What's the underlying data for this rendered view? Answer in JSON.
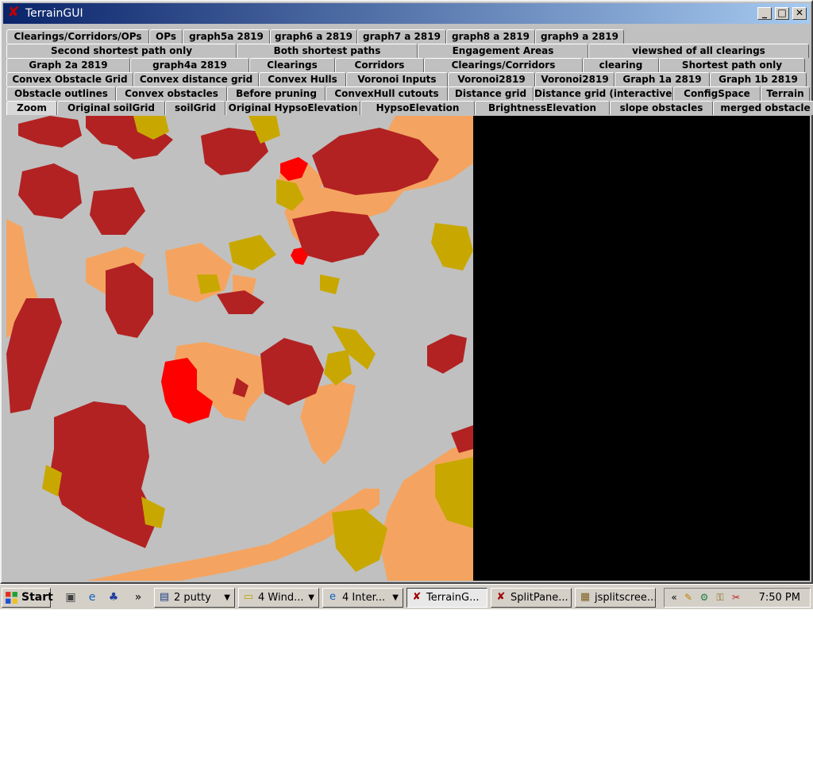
{
  "window": {
    "title": "TerrainGUI"
  },
  "tab_rows": [
    [
      "Clearings/Corridors/OPs",
      "OPs",
      "graph5a 2819",
      "graph6 a 2819",
      "graph7 a 2819",
      "graph8 a 2819",
      "graph9 a 2819"
    ],
    [
      "Second shortest path only",
      "Both shortest paths",
      "Engagement Areas",
      "viewshed of all clearings"
    ],
    [
      "Graph 2a 2819",
      "graph4a 2819",
      "Clearings",
      "Corridors",
      "Clearings/Corridors",
      "clearing",
      "Shortest path only"
    ],
    [
      "Convex Obstacle Grid",
      "Convex distance grid",
      "Convex Hulls",
      "Voronoi Inputs",
      "Voronoi2819",
      "Voronoi2819",
      "Graph 1a 2819",
      "Graph 1b 2819"
    ],
    [
      "Obstacle outlines",
      "Convex obstacles",
      "Before pruning",
      "ConvexHull cutouts",
      "Distance grid",
      "Distance grid (interactive)",
      "ConfigSpace",
      "Terrain"
    ],
    [
      "Zoom",
      "Original soilGrid",
      "soilGrid",
      "Original HypsoElevation",
      "HypsoElevation",
      "BrightnessElevation",
      "slope obstacles",
      "merged obstacle"
    ]
  ],
  "selected_tab": "Zoom",
  "map_colors": {
    "background": "#c0c0c0",
    "obstacle": "#b22222",
    "soil": "#f4a460",
    "vegetation": "#c8a800",
    "highlight": "#ff0000",
    "viewport": "#000000"
  },
  "taskbar": {
    "start_label": "Start",
    "buttons": [
      {
        "label": "2 putty",
        "icon": "putty-icon",
        "has_arrow": true
      },
      {
        "label": "4 Wind...",
        "icon": "folder-icon",
        "has_arrow": true
      },
      {
        "label": "4 Inter...",
        "icon": "internet-explorer-icon",
        "has_arrow": true
      },
      {
        "label": "TerrainG...",
        "icon": "java-app-icon",
        "has_arrow": false,
        "pressed": true
      },
      {
        "label": "SplitPane...",
        "icon": "java-app-icon",
        "has_arrow": false
      },
      {
        "label": "jsplitscree...",
        "icon": "image-icon",
        "has_arrow": false
      }
    ],
    "quick_launch_more": "»",
    "tray_expand": "«",
    "clock": "7:50 PM"
  }
}
